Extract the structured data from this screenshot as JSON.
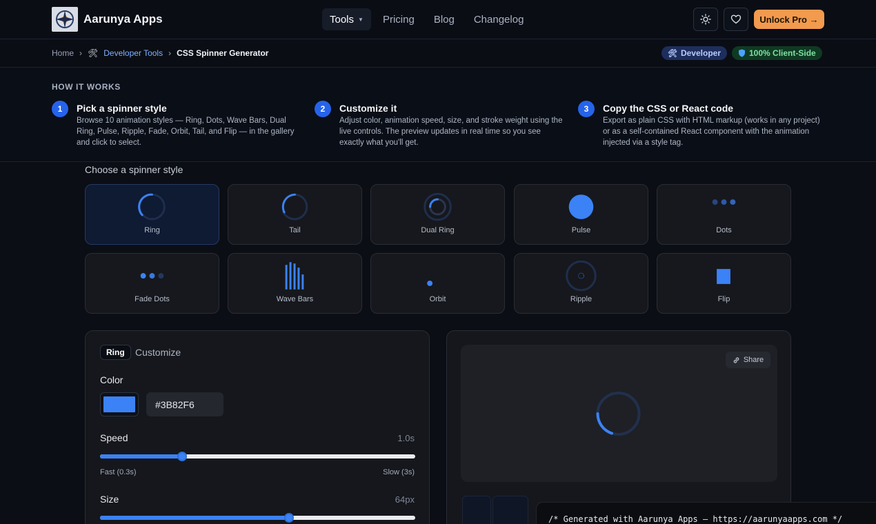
{
  "header": {
    "brand": "Aarunya Apps",
    "nav": [
      {
        "label": "Tools",
        "active": true,
        "has_dropdown": true
      },
      {
        "label": "Pricing",
        "active": false
      },
      {
        "label": "Blog",
        "active": false
      },
      {
        "label": "Changelog",
        "active": false
      }
    ],
    "theme_icon": "sun-icon",
    "favorite_icon": "heart-icon",
    "unlock_label": "Unlock Pro →",
    "unlock_color": "#f29a4e"
  },
  "breadcrumb": {
    "home": "Home",
    "sep": "›",
    "section": "Developer Tools",
    "current": "CSS Spinner Generator"
  },
  "badges": {
    "developer": "Developer",
    "client_side": "100% Client-Side"
  },
  "how_it_works": {
    "title": "HOW IT WORKS",
    "steps": [
      {
        "num": "1",
        "title": "Pick a spinner style",
        "desc": "Browse 10 animation styles — Ring, Dots, Wave Bars, Dual Ring, Pulse, Ripple, Fade, Orbit, Tail, and Flip — in the gallery and click to select."
      },
      {
        "num": "2",
        "title": "Customize it",
        "desc": "Adjust color, animation speed, size, and stroke weight using the live controls. The preview updates in real time so you see exactly what you'll get."
      },
      {
        "num": "3",
        "title": "Copy the CSS or React code",
        "desc": "Export as plain CSS with HTML markup (works in any project) or as a self-contained React component with the animation injected via a style tag."
      }
    ]
  },
  "gallery": {
    "title": "Choose a spinner style",
    "selected": "Ring",
    "styles": [
      "Ring",
      "Tail",
      "Dual Ring",
      "Pulse",
      "Dots",
      "Fade Dots",
      "Wave Bars",
      "Orbit",
      "Ripple",
      "Flip"
    ]
  },
  "customize": {
    "chip": "Ring",
    "heading": "Customize",
    "color_label": "Color",
    "color_value": "#3B82F6",
    "speed": {
      "label": "Speed",
      "value_text": "1.0s",
      "min_label": "Fast (0.3s)",
      "max_label": "Slow (3s)",
      "fraction": 0.26
    },
    "size": {
      "label": "Size",
      "value_text": "64px",
      "fraction": 0.6
    }
  },
  "preview": {
    "share_label": "Share",
    "share_icon": "link-icon",
    "accent": "#3b82f6"
  },
  "code": {
    "first_line": "/* Generated with Aarunya Apps — https://aarunyaapps.com */"
  }
}
